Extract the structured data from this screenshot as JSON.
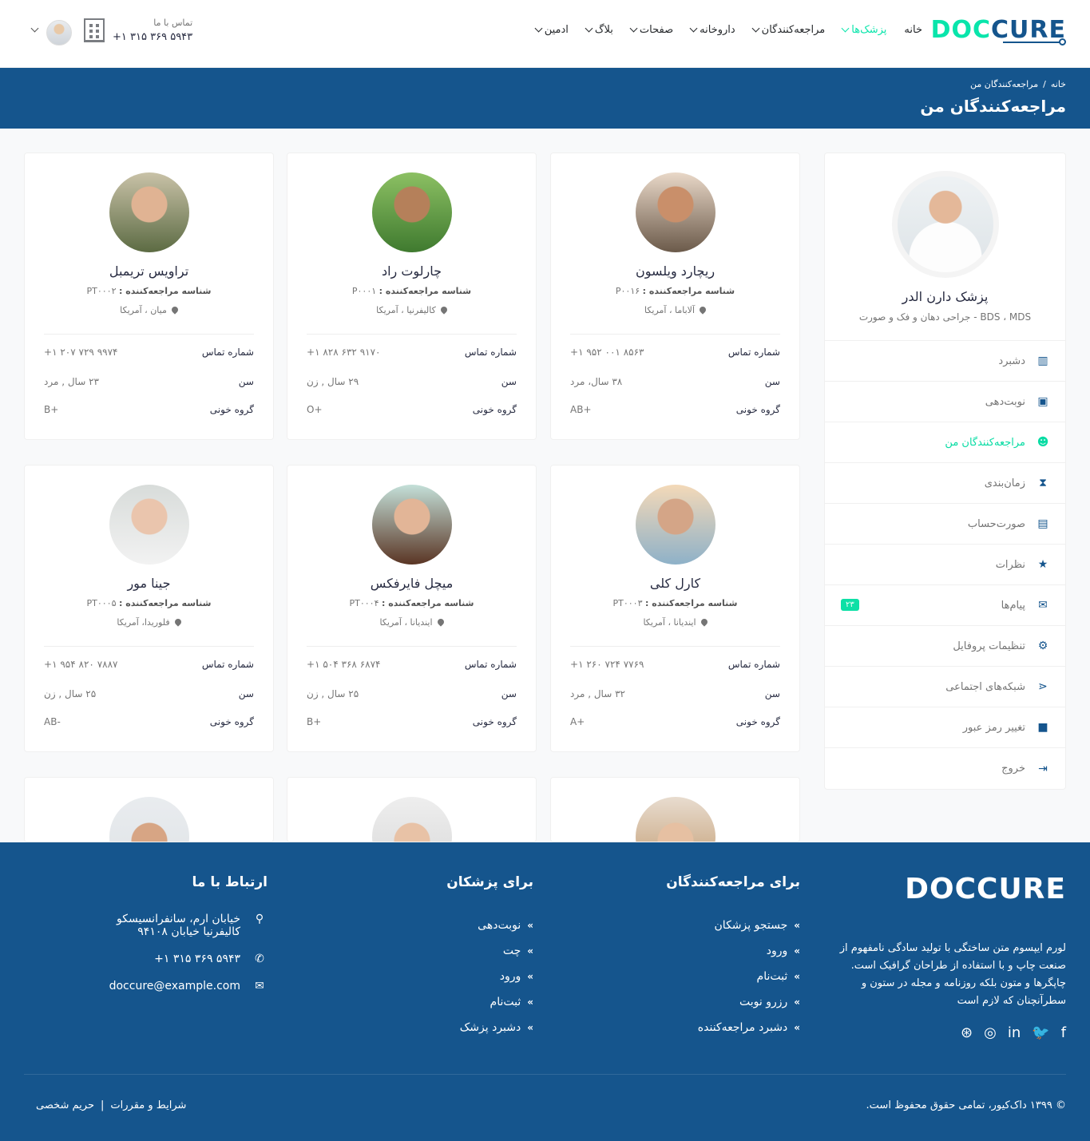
{
  "header": {
    "logo_prefix": "DOC",
    "logo_suffix": "CURE",
    "nav": [
      "خانه",
      "پزشک‌ها",
      "مراجعه‌کنندگان",
      "داروخانه",
      "صفحات",
      "بلاگ",
      "ادمین"
    ],
    "contact_label": "تماس با ما",
    "contact_number": "۵۹۴۳ ۳۶۹ ۳۱۵ ۱+"
  },
  "breadcrumb": {
    "home": "خانه",
    "sep": "/",
    "current": "مراجعه‌کنندگان من",
    "title": "مراجعه‌کنندگان من"
  },
  "sidebar": {
    "doctor_name": "پزشک دارن الدر",
    "doctor_spec": "BDS ، MDS - جراحی دهان و فک و صورت",
    "menu": [
      "دشبرد",
      "نوبت‌دهی",
      "مراجعه‌کنندگان من",
      "زمان‌بندی",
      "صورت‌حساب",
      "نظرات",
      "پیام‌ها",
      "تنظیمات پروفایل",
      "شبکه‌های اجتماعی",
      "تغییر رمز عبور",
      "خروج"
    ],
    "messages_badge": "۲۳"
  },
  "labels": {
    "patient_id": "شناسه مراجعه‌کننده :",
    "phone": "شماره تماس",
    "age": "سن",
    "blood": "گروه خونی"
  },
  "patients": [
    {
      "name": "ریچارد ویلسون",
      "id": "P۰۰۱۶",
      "location": "آلاباما ، آمریکا",
      "phone": "۸۵۶۳ ۰۰۱ ۹۵۲ ۱+",
      "age": "۳۸ سال، مرد",
      "blood": "AB+"
    },
    {
      "name": "چارلوت راد",
      "id": "P۰۰۰۱",
      "location": "کالیفرنیا ، آمریکا",
      "phone": "۹۱۷۰ ۶۳۲ ۸۲۸ ۱+",
      "age": "۲۹ سال , زن",
      "blood": "O+"
    },
    {
      "name": "تراویس تریمبل",
      "id": "PT۰۰۰۲",
      "location": "میان ، آمریکا",
      "phone": "۹۹۷۴ ۷۲۹ ۲۰۷ ۱+",
      "age": "۲۳ سال , مرد",
      "blood": "B+"
    },
    {
      "name": "کارل کلی",
      "id": "PT۰۰۰۳",
      "location": "ایندیانا ، آمریکا",
      "phone": "۷۷۶۹ ۷۲۴ ۲۶۰ ۱+",
      "age": "۳۲ سال , مرد",
      "blood": "A+"
    },
    {
      "name": "میچل فایرفکس",
      "id": "PT۰۰۰۴",
      "location": "ایندیانا ، آمریکا",
      "phone": "۶۸۷۴ ۳۶۸ ۵۰۴ ۱+",
      "age": "۲۵ سال , زن",
      "blood": "B+"
    },
    {
      "name": "جینا مور",
      "id": "PT۰۰۰۵",
      "location": "فلوریدا، آمریکا",
      "phone": "۷۸۸۷ ۸۲۰ ۹۵۴ ۱+",
      "age": "۲۵ سال , زن",
      "blood": "AB-"
    }
  ],
  "footer": {
    "logo_prefix": "DOC",
    "logo_suffix": "CURE",
    "about": "لورم ایپسوم متن ساختگی با تولید سادگی نامفهوم از صنعت چاپ و با استفاده از طراحان گرافیک است. چاپگرها و متون بلکه روزنامه و مجله در ستون و سطرآنچنان که لازم است",
    "patients_title": "برای مراجعه‌کنندگان",
    "patients_links": [
      "جستجو پزشکان",
      "ورود",
      "ثبت‌نام",
      "رزرو نوبت",
      "دشبرد مراجعه‌کننده"
    ],
    "doctors_title": "برای پزشکان",
    "doctors_links": [
      "نوبت‌دهی",
      "چت",
      "ورود",
      "ثبت‌نام",
      "دشبرد پزشک"
    ],
    "contact_title": "ارتباط با ما",
    "address_line1": "خیابان ارم، سانفرانسیسکو",
    "address_line2": "کالیفرنیا خیابان ۹۴۱۰۸",
    "phone": "۵۹۴۳ ۳۶۹ ۳۱۵ ۱+",
    "email": "doccure@example.com",
    "copyright": "© ۱۳۹۹ داک‌کیور، تمامی حقوق محفوظ است.",
    "terms": "شرایط و مقررات",
    "policy_sep": "|",
    "privacy": "حریم شخصی"
  },
  "colors": {
    "primary": "#15558d",
    "accent": "#09e5ab"
  }
}
